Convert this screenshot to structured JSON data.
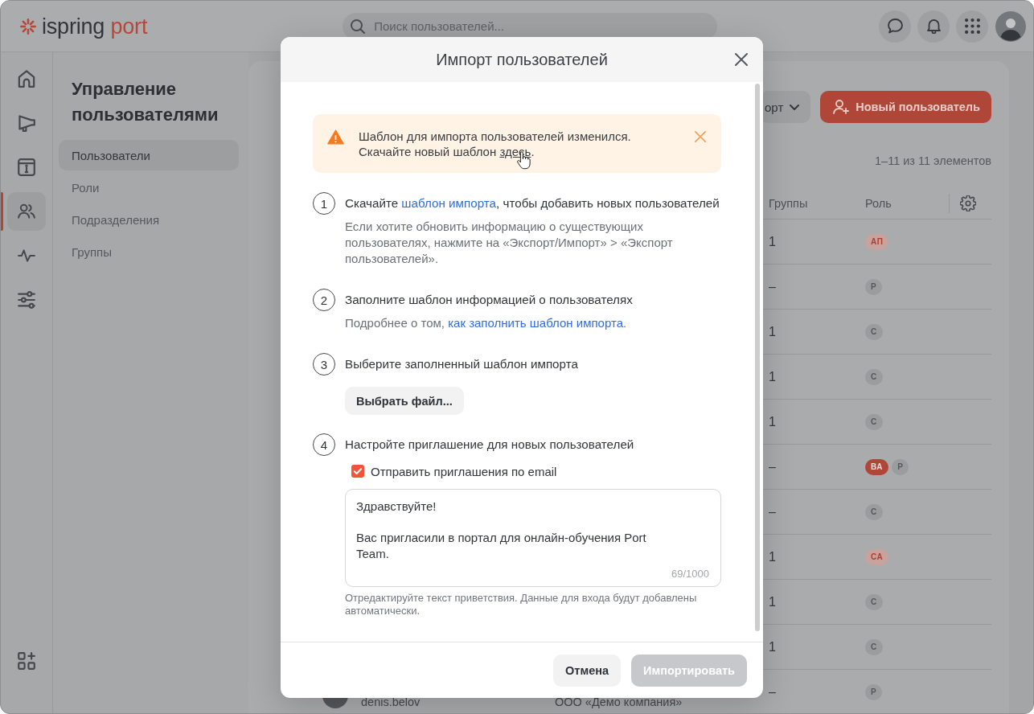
{
  "header": {
    "logo": {
      "brand": "ispring",
      "product": "port"
    },
    "search": {
      "placeholder": "Поиск пользователей..."
    }
  },
  "rail": {
    "items": [
      {
        "selected": false
      },
      {
        "selected": false
      },
      {
        "selected": false
      },
      {
        "selected": true
      },
      {
        "selected": false
      },
      {
        "selected": false
      }
    ]
  },
  "sidebar": {
    "title": "Управление пользователями",
    "items": [
      {
        "label": "Пользователи",
        "selected": true
      },
      {
        "label": "Роли",
        "selected": false
      },
      {
        "label": "Подразделения",
        "selected": false
      },
      {
        "label": "Группы",
        "selected": false
      }
    ]
  },
  "content": {
    "export_button": {
      "label": "орт"
    },
    "new_user_button": {
      "label": "Новый пользователь"
    },
    "count": "1–11 из 11 элементов",
    "table": {
      "columns": [
        "Группы",
        "Роль"
      ],
      "rows": [
        {
          "groups": "1",
          "roles": [
            {
              "label": "АП",
              "kind": "soft"
            }
          ]
        },
        {
          "groups": "–",
          "roles": [
            {
              "label": "Р",
              "kind": "plain"
            }
          ]
        },
        {
          "groups": "1",
          "roles": [
            {
              "label": "С",
              "kind": "plain"
            }
          ]
        },
        {
          "groups": "1",
          "roles": [
            {
              "label": "С",
              "kind": "plain"
            }
          ]
        },
        {
          "groups": "1",
          "roles": [
            {
              "label": "С",
              "kind": "plain"
            }
          ]
        },
        {
          "groups": "–",
          "roles": [
            {
              "label": "ВА",
              "kind": "solid"
            },
            {
              "label": "Р",
              "kind": "plain"
            }
          ]
        },
        {
          "groups": "–",
          "roles": [
            {
              "label": "С",
              "kind": "plain"
            }
          ]
        },
        {
          "groups": "1",
          "roles": [
            {
              "label": "СА",
              "kind": "soft"
            }
          ]
        },
        {
          "groups": "1",
          "roles": [
            {
              "label": "С",
              "kind": "plain"
            }
          ]
        },
        {
          "groups": "1",
          "roles": [
            {
              "label": "С",
              "kind": "plain"
            }
          ]
        },
        {
          "groups": "–",
          "roles": [
            {
              "label": "Р",
              "kind": "plain"
            }
          ],
          "login": "denis.belov",
          "company": "ООО «Демо компания»"
        }
      ]
    }
  },
  "modal": {
    "title": "Импорт пользователей",
    "alert": {
      "line1": "Шаблон для импорта пользователей изменился.",
      "line2": "Скачайте новый шаблон",
      "link": "здесь",
      "line2_end": "."
    },
    "steps": [
      {
        "kind": "text",
        "number": "1",
        "title": {
          "before": "Скачайте",
          "link": "шаблон импорта",
          "after": ", чтобы добавить новых пользователей"
        },
        "description": {
          "before": "Если хотите обновить информацию о существующих пользователях, нажмите на «Экспорт/Импорт» > «Экспорт пользователей»."
        }
      },
      {
        "kind": "text",
        "number": "2",
        "title": {
          "before": "Заполните шаблон информацией о пользователях"
        },
        "description": {
          "before": "Подробнее о том,",
          "link": "как заполнить шаблон импорта",
          "after": "."
        }
      },
      {
        "kind": "file",
        "number": "3",
        "title": {
          "before": "Выберите заполненный шаблон импорта"
        },
        "button": {
          "label": "Выбрать файл..."
        }
      },
      {
        "kind": "invite",
        "number": "4",
        "title": {
          "before": "Настройте приглашение для новых пользователей"
        },
        "checkbox": {
          "label": "Отправить приглашения по email",
          "checked": true
        },
        "message": {
          "value": "Здравствуйте!\n\nВас пригласили в портал для онлайн-обучения Port Team.",
          "counter": "69/1000"
        },
        "hint": "Отредактируйте текст приветствия. Данные для входа будут добавлены автоматически."
      }
    ],
    "footer": {
      "cancel_button": {
        "label": "Отмена"
      },
      "import_button": {
        "label": "Импортировать",
        "disabled": true
      }
    }
  }
}
